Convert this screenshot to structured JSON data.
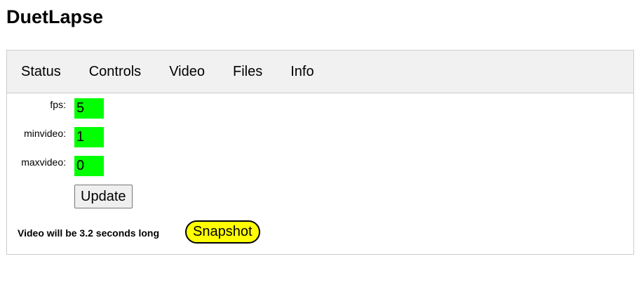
{
  "app": {
    "title": "DuetLapse"
  },
  "tabs": [
    {
      "label": "Status"
    },
    {
      "label": "Controls"
    },
    {
      "label": "Video"
    },
    {
      "label": "Files"
    },
    {
      "label": "Info"
    }
  ],
  "video_settings": {
    "fields": [
      {
        "label": "fps:",
        "value": "5"
      },
      {
        "label": "minvideo:",
        "value": "1"
      },
      {
        "label": "maxvideo:",
        "value": "0"
      }
    ],
    "update_label": "Update",
    "length_text": "Video will be 3.2 seconds long",
    "snapshot_label": "Snapshot"
  },
  "colors": {
    "input_background": "#00ff00",
    "snapshot_background": "#ffff00",
    "tab_bar_background": "#f1f1f1"
  }
}
